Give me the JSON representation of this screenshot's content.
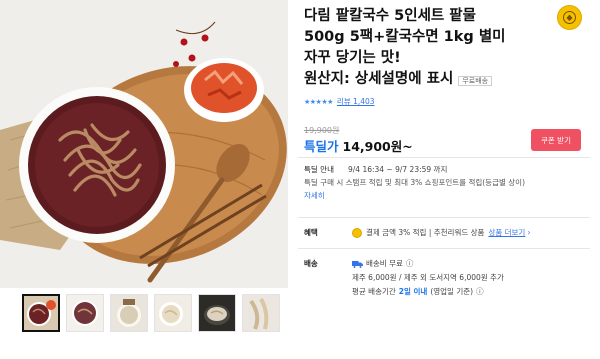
{
  "colors": {
    "deal_blue": "#1a73e8",
    "link_blue": "#3474e6",
    "coupon_red": "#ef5163",
    "star_blue": "#3c8cf0",
    "badge_yellow": "#f5c000"
  },
  "product": {
    "title_lines": [
      "다림 팥칼국수 5인세트 팥물",
      "500g 5팩+칼국수면 1kg 별미",
      "자꾸 당기는 맛!",
      "원산지: 상세설명에 표시"
    ],
    "origin_badge": "무료배송",
    "brand_badge_icon": "brand-emblem-icon"
  },
  "rating": {
    "stars": "★★★★★",
    "stars_value": 5,
    "review_text": "리뷰 1,403"
  },
  "price": {
    "original": "19,900원",
    "deal_label": "특딜가",
    "deal_price": "14,900원~",
    "coupon_button": "쿠폰 받기"
  },
  "deal_guide": {
    "label": "특딜 안내",
    "period": "9/4 16:34 ~ 9/7 23:59 까지",
    "description": "특딜 구매 시 스탬프 적립 및 최대 3% 쇼핑포인트를 적립(등급별 상이)",
    "detail_link": "자세히"
  },
  "benefit": {
    "label": "혜택",
    "icon": "coin-icon",
    "text": "결제 금액 3% 적립 | 추천리워드 상품",
    "more_link": "상품 더보기",
    "chevron": "›"
  },
  "shipping": {
    "label": "배송",
    "icon": "truck-icon",
    "fee": "배송비 무료",
    "fee_help": "ⓘ",
    "extra": "제주 6,000원 / 제주 외 도서지역 6,000원 추가",
    "avg_prefix": "평균 배송기간",
    "avg_days": "2일 이내",
    "avg_suffix": "(영업일 기준)",
    "avg_help": "ⓘ"
  },
  "gallery": {
    "thumbnails": [
      "thumb-1",
      "thumb-2",
      "thumb-3",
      "thumb-4",
      "thumb-5",
      "thumb-6"
    ],
    "selected_index": 0
  }
}
